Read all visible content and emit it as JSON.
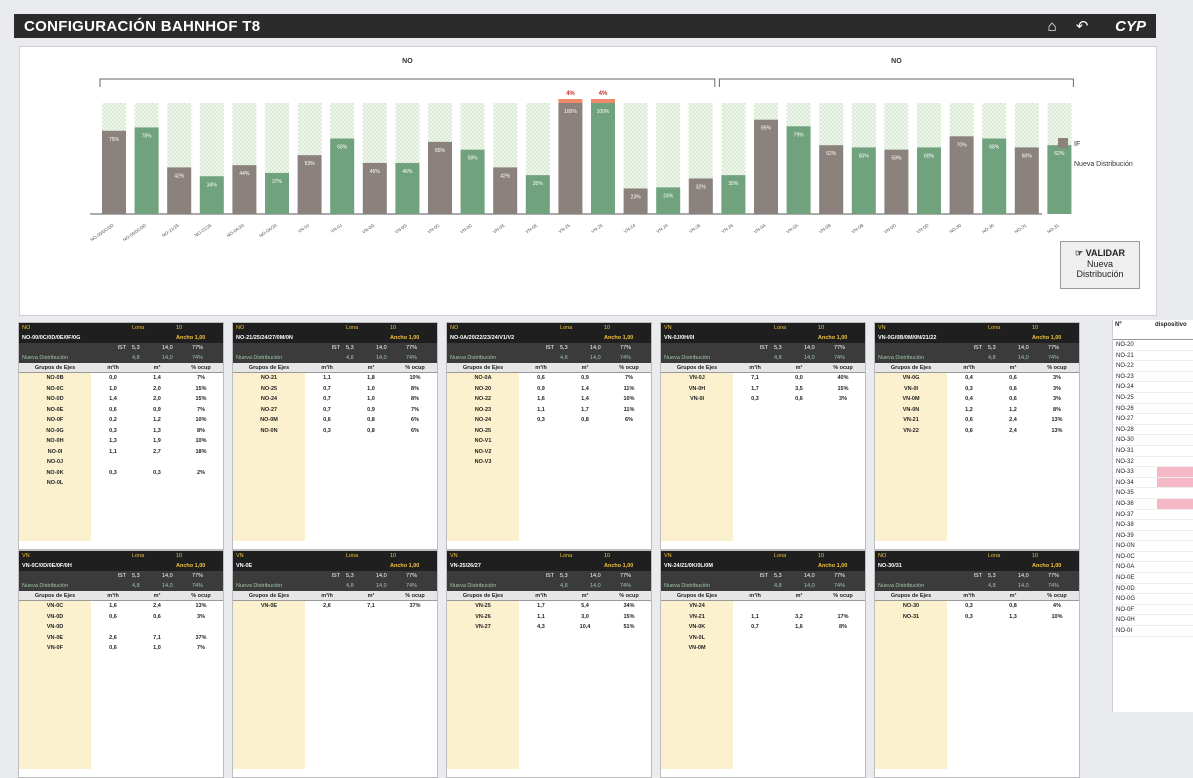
{
  "header": {
    "title": "CONFIGURACIÓN BAHNHOF T8",
    "logo": "CYP"
  },
  "chart_data": {
    "type": "bar",
    "groups": [
      {
        "label": "NO",
        "span": [
          0,
          18
        ]
      },
      {
        "label": "NO",
        "span": [
          19,
          29
        ]
      }
    ],
    "categories": [
      "NO-00/0C/0D",
      "NO-00/0C/0D",
      "NO-21/25",
      "NO-21/25",
      "NO-0A/20",
      "NO-0A/20",
      "VN-0J",
      "VN-0J",
      "VN-0G",
      "VN-0G",
      "VN-0C",
      "VN-0C",
      "VN-0E",
      "VN-0E",
      "VN-25",
      "VN-25",
      "VN-24",
      "VN-24",
      "VN-26",
      "VN-26",
      "VN-0A",
      "VN-0A",
      "VN-0B",
      "VN-0B",
      "VN-0D",
      "VN-0D",
      "NO-30",
      "NO-30",
      "NO-31",
      "NO-31"
    ],
    "series": [
      {
        "name": "IF",
        "color": "#8c827d",
        "values": [
          75,
          78,
          42,
          34,
          44,
          37,
          53,
          68,
          46,
          46,
          65,
          58,
          42,
          35,
          100,
          100,
          23,
          24,
          32,
          35,
          85,
          79,
          62,
          60,
          58,
          60,
          70,
          68,
          60,
          62
        ]
      },
      {
        "name": "Nueva Distribución",
        "color": "#6fa27d",
        "values": []
      }
    ],
    "series_colors": [
      "#8c827d",
      "#6fa27d",
      "#8c827d",
      "#6fa27d"
    ],
    "bar_labels": [
      "75%",
      "78%",
      "42%",
      "34%",
      "44%",
      "37%",
      "53%",
      "68%",
      "46%",
      "46%",
      "65%",
      "58%",
      "42%",
      "35%",
      "100%",
      "100%",
      "23%",
      "24%",
      "32%",
      "35%",
      "85%",
      "79%",
      "62%",
      "60%",
      "58%",
      "60%",
      "70%",
      "68%",
      "60%",
      "62%"
    ],
    "overflow_labels": [
      {
        "index": 14,
        "text": "4%"
      },
      {
        "index": 15,
        "text": "4%"
      }
    ],
    "legend": [
      "IF",
      "Nueva Distribución"
    ],
    "ylim": [
      0,
      100
    ]
  },
  "validar": {
    "line1": "VALIDAR",
    "line2": "Nueva",
    "line3": "Distribución"
  },
  "cards": [
    {
      "head": "NO",
      "group": "NO-00/0C/0D/0E/0F/0G",
      "rows": [
        [
          "NO-0B",
          "0,0",
          "1,4",
          "7%"
        ],
        [
          "NO-0C",
          "1,0",
          "2,0",
          "15%"
        ],
        [
          "NO-0D",
          "1,4",
          "2,0",
          "15%"
        ],
        [
          "NO-0E",
          "0,6",
          "0,9",
          "7%"
        ],
        [
          "NO-0F",
          "0,2",
          "1,2",
          "10%"
        ],
        [
          "NO-0G",
          "0,3",
          "1,3",
          "8%"
        ],
        [
          "NO-0H",
          "1,3",
          "1,9",
          "10%"
        ],
        [
          "NO-0I",
          "1,1",
          "2,7",
          "18%"
        ],
        [
          "NO-0J",
          "",
          "",
          ""
        ],
        [
          "NO-0K",
          "0,3",
          "0,3",
          "2%"
        ],
        [
          "NO-0L",
          "",
          "",
          ""
        ]
      ]
    },
    {
      "head": "NO",
      "group": "NO-21/25/24/27/0M/0N",
      "rows": [
        [
          "NO-21",
          "1,1",
          "1,8",
          "10%"
        ],
        [
          "NO-25",
          "0,7",
          "1,0",
          "8%"
        ],
        [
          "NO-24",
          "0,7",
          "1,0",
          "8%"
        ],
        [
          "NO-27",
          "0,7",
          "0,9",
          "7%"
        ],
        [
          "NO-0M",
          "0,6",
          "0,8",
          "6%"
        ],
        [
          "NO-0N",
          "0,3",
          "0,8",
          "6%"
        ]
      ]
    },
    {
      "head": "NO",
      "group": "NO-0A/20/22/23/24/V1/V2",
      "rows": [
        [
          "NO-0A",
          "0,6",
          "0,9",
          "7%"
        ],
        [
          "NO-20",
          "0,9",
          "1,4",
          "11%"
        ],
        [
          "NO-22",
          "1,6",
          "1,4",
          "10%"
        ],
        [
          "NO-23",
          "1,1",
          "1,7",
          "11%"
        ],
        [
          "NO-24",
          "0,3",
          "0,8",
          "6%"
        ],
        [
          "NO-25",
          "",
          "",
          ""
        ],
        [
          "NO-V1",
          "",
          "",
          ""
        ],
        [
          "NO-V2",
          "",
          "",
          ""
        ],
        [
          "NO-V3",
          "",
          "",
          ""
        ]
      ]
    },
    {
      "head": "VN",
      "group": "VN-0J/0H/0I",
      "rows": [
        [
          "VN-0J",
          "7,1",
          "0,0",
          "40%"
        ],
        [
          "VN-0H",
          "1,7",
          "3,5",
          "15%"
        ],
        [
          "VN-0I",
          "0,3",
          "0,6",
          "3%"
        ]
      ]
    },
    {
      "head": "VN",
      "group": "VN-0G/0B/0M/0N/21/22",
      "rows": [
        [
          "VN-0G",
          "0,4",
          "0,6",
          "3%"
        ],
        [
          "VN-0I",
          "0,3",
          "0,6",
          "3%"
        ],
        [
          "VN-0M",
          "0,4",
          "0,6",
          "3%"
        ],
        [
          "VN-0N",
          "1,2",
          "1,2",
          "8%"
        ],
        [
          "VN-21",
          "0,6",
          "2,4",
          "13%"
        ],
        [
          "VN-22",
          "0,6",
          "2,4",
          "13%"
        ]
      ]
    },
    {
      "head": "VN",
      "group": "VN-0C/0D/0E/0F/0H",
      "rows": [
        [
          "VN-0C",
          "1,6",
          "2,4",
          "13%"
        ],
        [
          "VN-0D",
          "0,6",
          "0,6",
          "3%"
        ],
        [
          "VN-0D",
          "",
          "",
          ""
        ],
        [
          "VN-0E",
          "2,6",
          "7,1",
          "37%"
        ],
        [
          "VN-0F",
          "0,6",
          "1,0",
          "7%"
        ]
      ]
    },
    {
      "head": "VN",
      "group": "VN-0E",
      "rows": [
        [
          "VN-0E",
          "2,6",
          "7,1",
          "37%"
        ]
      ]
    },
    {
      "head": "VN",
      "group": "VN-25/26/27",
      "rows": [
        [
          "VN-25",
          "1,7",
          "5,4",
          "34%"
        ],
        [
          "VN-26",
          "1,1",
          "3,0",
          "15%"
        ],
        [
          "VN-27",
          "4,3",
          "10,4",
          "51%"
        ]
      ]
    },
    {
      "head": "VN",
      "group": "VN-24/21/0K/0L/0M",
      "rows": [
        [
          "VN-24",
          "",
          "",
          ""
        ],
        [
          "VN-21",
          "1,1",
          "3,2",
          "17%"
        ],
        [
          "VN-0K",
          "0,7",
          "1,6",
          "8%"
        ],
        [
          "VN-0L",
          "",
          "",
          ""
        ],
        [
          "VN-0M",
          "",
          "",
          ""
        ]
      ]
    },
    {
      "head": "NO",
      "group": "NO-30/31",
      "rows": [
        [
          "NO-30",
          "0,3",
          "0,8",
          "4%"
        ],
        [
          "NO-31",
          "0,3",
          "1,3",
          "10%"
        ]
      ]
    }
  ],
  "card_labels": {
    "lona": "Lona",
    "ancho": "Ancho",
    "val_lona": "10",
    "val_ancho": "1,00",
    "ist": "IST",
    "nueva": "Nueva Distribución",
    "col1": "Grupos de Ejes",
    "col2": "m³/h",
    "col3": "m³",
    "col4": "% ocup"
  },
  "card_stats": [
    [
      "IST",
      "5,3",
      "14,0",
      "77%"
    ],
    [
      "Nueva Distribución",
      "4,8",
      "14,0",
      "74%"
    ]
  ],
  "rightlist": {
    "h1": "Nº",
    "h2": "dispositivo",
    "items": [
      "NO-20",
      "NO-21",
      "NO-22",
      "NO-23",
      "NO-24",
      "NO-25",
      "NO-26",
      "NO-27",
      "NO-28",
      "NO-30",
      "NO-31",
      "NO-32",
      "NO-33",
      "NO-34",
      "NO-35",
      "NO-36",
      "NO-37",
      "NO-38",
      "NO-39",
      "NO-0N",
      "NO-0C",
      "NO-0A",
      "NO-0E",
      "NO-0D",
      "NO-0G",
      "NO-0F",
      "NO-0H",
      "NO-0I"
    ],
    "marked": [
      12,
      13,
      15
    ]
  }
}
